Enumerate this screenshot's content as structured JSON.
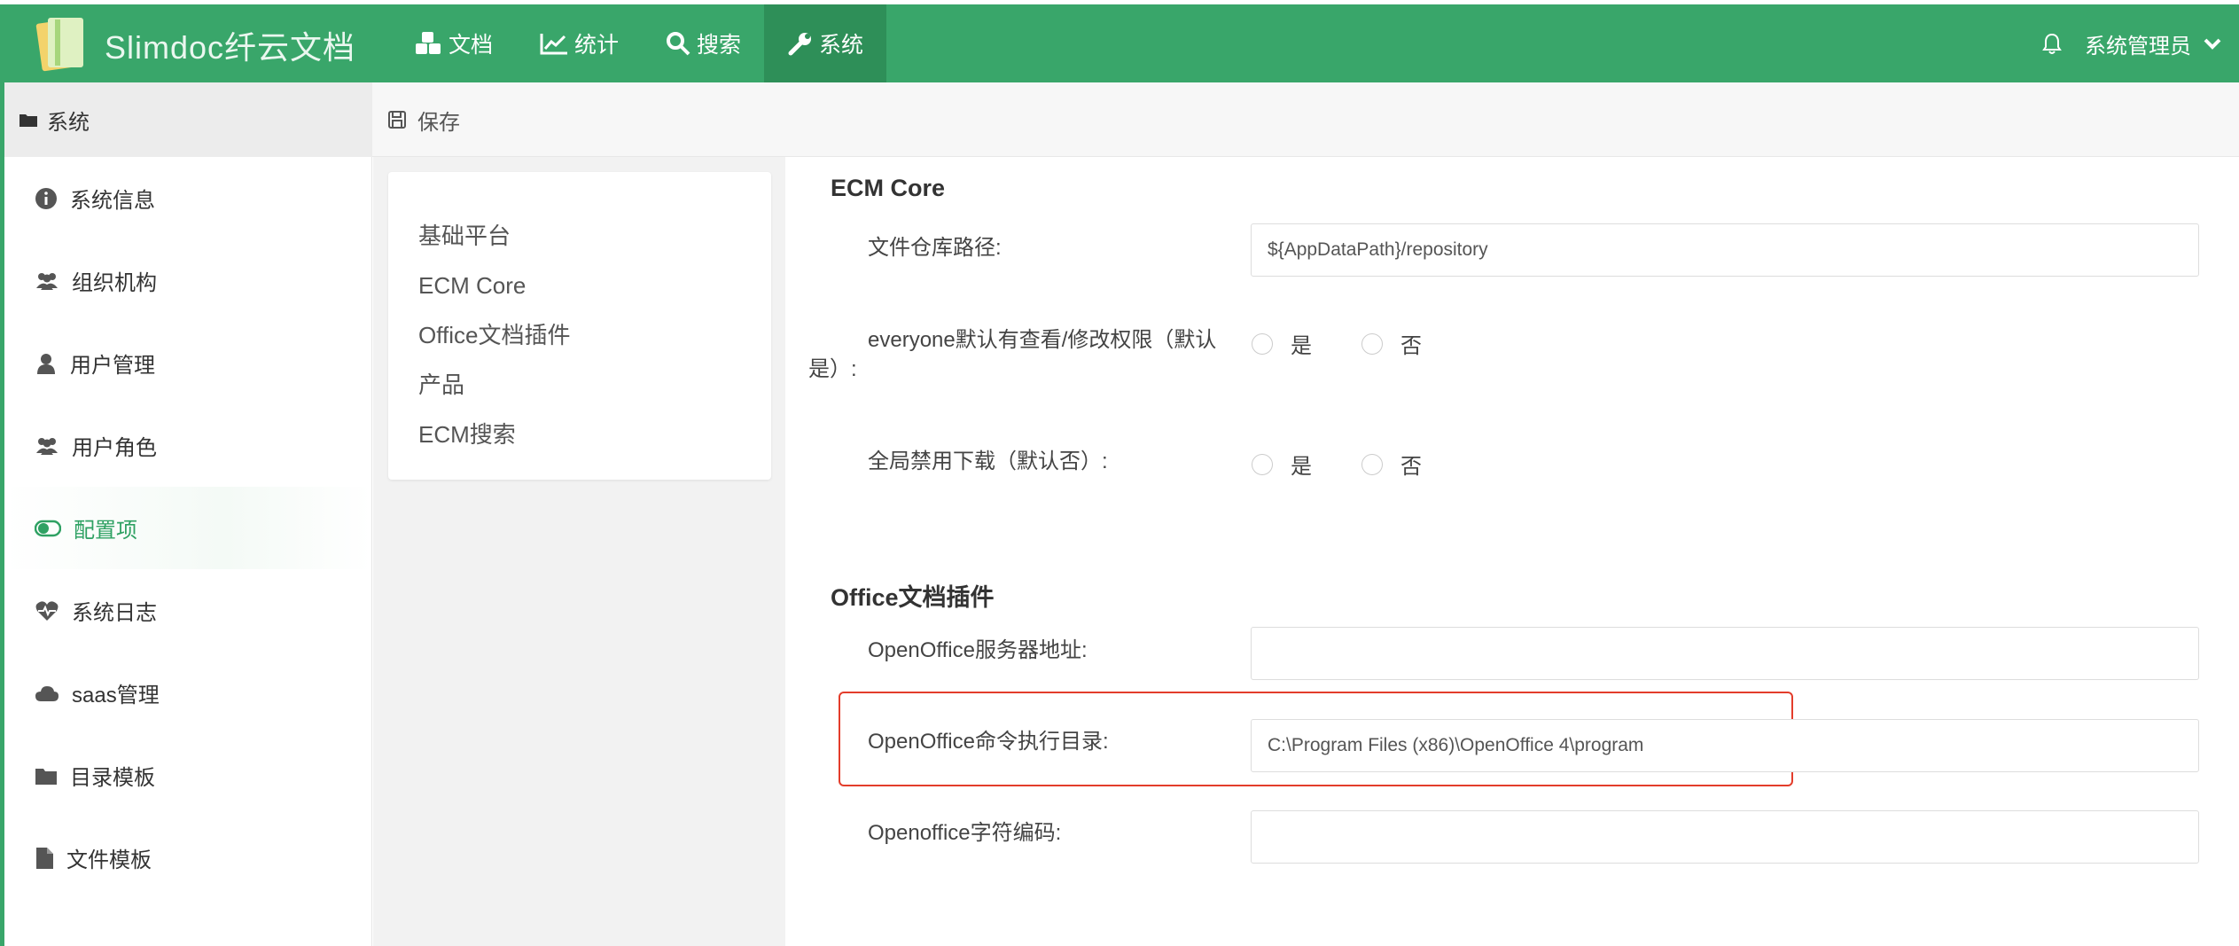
{
  "header": {
    "brand": "Slimdoc纤云文档",
    "nav": [
      {
        "label": "文档",
        "icon": "cubes-icon"
      },
      {
        "label": "统计",
        "icon": "chart-line-icon"
      },
      {
        "label": "搜索",
        "icon": "search-icon"
      },
      {
        "label": "系统",
        "icon": "wrench-icon",
        "active": true
      }
    ],
    "user": "系统管理员"
  },
  "subbar": {
    "section": "系统",
    "save": "保存"
  },
  "sidebar": {
    "items": [
      {
        "label": "系统信息",
        "icon": "info-icon"
      },
      {
        "label": "组织机构",
        "icon": "users-icon"
      },
      {
        "label": "用户管理",
        "icon": "user-icon"
      },
      {
        "label": "用户角色",
        "icon": "users-icon"
      },
      {
        "label": "配置项",
        "icon": "toggle-icon",
        "active": true
      },
      {
        "label": "系统日志",
        "icon": "heartbeat-icon"
      },
      {
        "label": "saas管理",
        "icon": "cloud-icon"
      },
      {
        "label": "目录模板",
        "icon": "folder-icon"
      },
      {
        "label": "文件模板",
        "icon": "file-icon"
      }
    ]
  },
  "toc": [
    "基础平台",
    "ECM Core",
    "Office文档插件",
    "产品",
    "ECM搜索"
  ],
  "sections": {
    "ecm": {
      "title": "ECM Core",
      "repo_label": "文件仓库路径:",
      "repo_value": "${AppDataPath}/repository",
      "everyone_label_1": "everyone默认有查看/修改权限（默认",
      "everyone_label_2": "是）:",
      "download_label": "全局禁用下载（默认否）:",
      "yes": "是",
      "no": "否"
    },
    "office": {
      "title": "Office文档插件",
      "server_label": "OpenOffice服务器地址:",
      "server_value": "",
      "cmd_label": "OpenOffice命令执行目录:",
      "cmd_value": "C:\\Program Files (x86)\\OpenOffice 4\\program",
      "charset_label": "Openoffice字符编码:",
      "charset_value": ""
    }
  },
  "colors": {
    "header": "#39a66a",
    "active_nav": "#2e8f58",
    "accent": "#2fa163",
    "highlight": "#e33d2b"
  }
}
